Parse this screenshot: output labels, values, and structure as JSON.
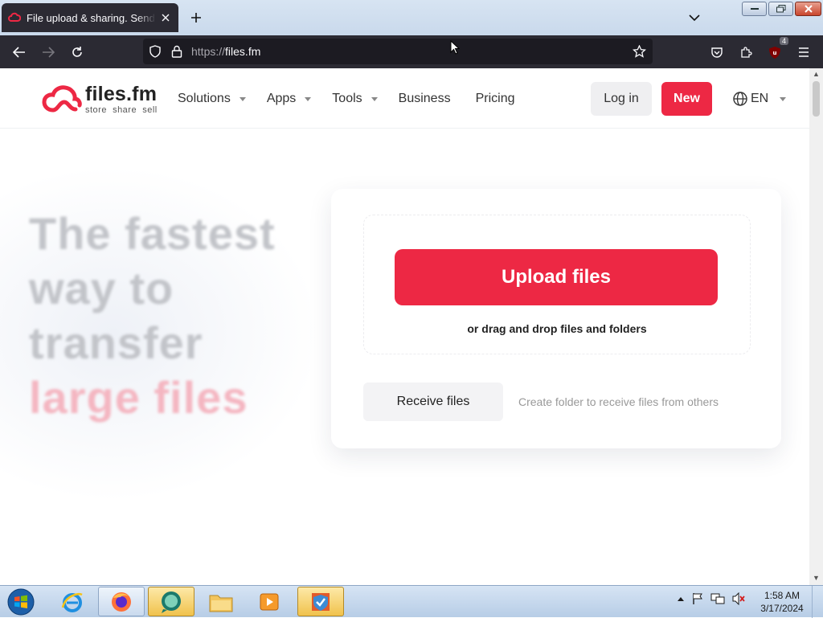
{
  "browser": {
    "tab_title": "File upload & sharing. Send large files",
    "url_scheme": "https://",
    "url_host": "files.fm",
    "extension_badge": "4"
  },
  "site": {
    "logo_name": "files.fm",
    "logo_tagline": "store  share  sell",
    "menu": [
      {
        "label": "Solutions",
        "has_dropdown": true
      },
      {
        "label": "Apps",
        "has_dropdown": true
      },
      {
        "label": "Tools",
        "has_dropdown": true
      },
      {
        "label": "Business",
        "has_dropdown": false
      },
      {
        "label": "Pricing",
        "has_dropdown": false
      }
    ],
    "login_label": "Log in",
    "new_label": "New",
    "language": "EN",
    "brand_color": "#ed2844"
  },
  "hero": {
    "line1": "The fastest",
    "line2": "way to",
    "line3": "transfer",
    "line4": "large files"
  },
  "upload_card": {
    "upload_label": "Upload files",
    "drag_text": "or drag and drop files and folders",
    "receive_label": "Receive files",
    "receive_hint": "Create folder to receive files from others"
  },
  "taskbar": {
    "apps": [
      "internet-explorer",
      "firefox",
      "chat-app",
      "file-explorer",
      "media-player",
      "security-app"
    ],
    "time": "1:58 AM",
    "date": "3/17/2024"
  }
}
